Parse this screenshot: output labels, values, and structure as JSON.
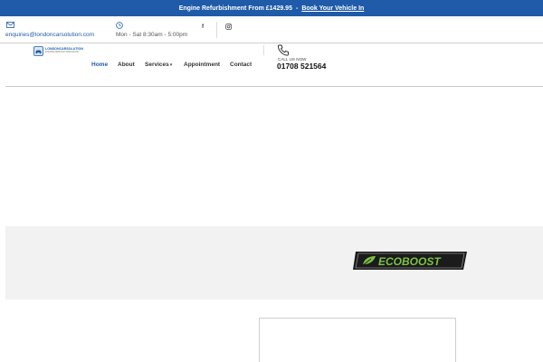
{
  "topbar": {
    "promo": "Engine Refurbishment From £1429.95",
    "separator": "-",
    "cta": "Book Your Vehicle In",
    "bg": "#1f5ba8"
  },
  "contact": {
    "email": "enquiries@londoncarsolution.com",
    "hours": "Mon - Sat 8:30am - 5:00pm"
  },
  "social": {
    "facebook": "f"
  },
  "logo": {
    "line1": "LONDONCARSOLUTION",
    "line2": "ENGINE REBUILD SPECIALIST"
  },
  "nav": {
    "items": [
      {
        "label": "Home"
      },
      {
        "label": "About"
      },
      {
        "label": "Services"
      },
      {
        "label": "Appointment"
      },
      {
        "label": "Contact"
      }
    ]
  },
  "call": {
    "label": "CALL US NOW",
    "number": "01708 521564"
  },
  "ecoboost": {
    "text": "ECOBOOST"
  },
  "colors": {
    "brand_blue": "#1f5ba8",
    "eco_green": "#7cc242"
  }
}
